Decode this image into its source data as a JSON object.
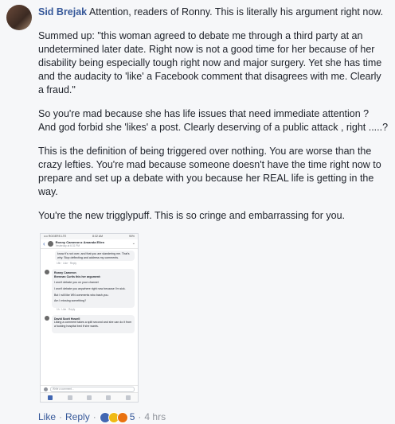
{
  "comment": {
    "author": "Sid Brejak",
    "intro": "Attention, readers of Ronny. This is literally his argument right now.",
    "paragraphs": [
      "Summed up: \"this woman agreed to debate me through a third party at an undetermined later date. Right now is not a good time for her because of her disability being especially tough right now and major surgery. Yet she has time and the audacity to 'like' a Facebook comment that disagrees with me. Clearly a fraud.\"",
      "So you're mad because she has life issues that need immediate attention ? And god forbid she 'likes' a post. Clearly deserving of a public attack , right .....?",
      "This is the definition of being triggered over nothing. You are worse than the crazy lefties. You're mad because someone doesn't have the time right now to prepare and set up a debate with you because her REAL life is getting in the way.",
      "You're the new trigglypuff. This is so cringe and embarrassing for you."
    ],
    "actions": {
      "like": "Like",
      "reply": "Reply",
      "reaction_count": "5",
      "time": "4 hrs",
      "separator": "·"
    }
  },
  "screenshot": {
    "status_left": "•••• ROGERS LTE",
    "status_time": "8:32 AM",
    "status_right": "90%",
    "header_title": "Ronny Cameron ▸ Amanda Ellen",
    "header_sub": "Yesterday at 6:31 PM",
    "top_bubble": "know it's not over, and that you are slandering me. That's why. Stop deflecting and address my comments.",
    "top_actions": "15h · Like · Reply",
    "post_author": "Ronny Cameron",
    "post_lead": "Brennan Curtis this her argument:",
    "post_lines": [
      "I won't debate you on your channel",
      "I won't debate you anywhere right now because I'm sick.",
      "But I will like WN comments who bash you.",
      "Am I missing something?"
    ],
    "post_actions": "1h · Like · Reply",
    "reply_author": "David Scott Howell",
    "reply_text": "Liking a comment takes a split second and she can do it from a fucking hospital bed if she wants.",
    "input_placeholder": "Write a comment..."
  }
}
